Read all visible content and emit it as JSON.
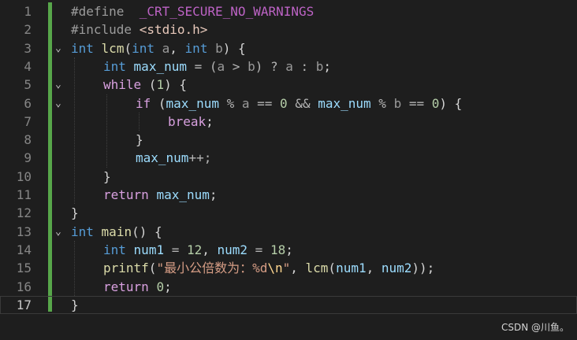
{
  "editor": {
    "lines": [
      {
        "num": "1",
        "fold": "",
        "tokens": [
          {
            "t": "#define",
            "c": "pre"
          },
          {
            "t": "  ",
            "c": "punct"
          },
          {
            "t": "_CRT_SECURE_NO_WARNINGS",
            "c": "macro"
          }
        ],
        "indent": 0
      },
      {
        "num": "2",
        "fold": "",
        "tokens": [
          {
            "t": "#include",
            "c": "pre"
          },
          {
            "t": " ",
            "c": "punct"
          },
          {
            "t": "<stdio.h>",
            "c": "inc"
          }
        ],
        "indent": 0
      },
      {
        "num": "3",
        "fold": "⌄",
        "tokens": [
          {
            "t": "int",
            "c": "kw"
          },
          {
            "t": " ",
            "c": "punct"
          },
          {
            "t": "lcm",
            "c": "fn"
          },
          {
            "t": "(",
            "c": "punct"
          },
          {
            "t": "int",
            "c": "kw"
          },
          {
            "t": " ",
            "c": "punct"
          },
          {
            "t": "a",
            "c": "param"
          },
          {
            "t": ", ",
            "c": "punct"
          },
          {
            "t": "int",
            "c": "kw"
          },
          {
            "t": " ",
            "c": "punct"
          },
          {
            "t": "b",
            "c": "param"
          },
          {
            "t": ") {",
            "c": "punct"
          }
        ],
        "indent": 0
      },
      {
        "num": "4",
        "fold": "",
        "tokens": [
          {
            "t": "int",
            "c": "kw"
          },
          {
            "t": " ",
            "c": "punct"
          },
          {
            "t": "max_num",
            "c": "var"
          },
          {
            "t": " = (",
            "c": "op"
          },
          {
            "t": "a",
            "c": "param"
          },
          {
            "t": " > ",
            "c": "op"
          },
          {
            "t": "b",
            "c": "param"
          },
          {
            "t": ") ? ",
            "c": "op"
          },
          {
            "t": "a",
            "c": "param"
          },
          {
            "t": " : ",
            "c": "op"
          },
          {
            "t": "b",
            "c": "param"
          },
          {
            "t": ";",
            "c": "punct"
          }
        ],
        "indent": 1
      },
      {
        "num": "5",
        "fold": "⌄",
        "tokens": [
          {
            "t": "while",
            "c": "ctrl"
          },
          {
            "t": " (",
            "c": "punct"
          },
          {
            "t": "1",
            "c": "num"
          },
          {
            "t": ") {",
            "c": "punct"
          }
        ],
        "indent": 1
      },
      {
        "num": "6",
        "fold": "⌄",
        "tokens": [
          {
            "t": "if",
            "c": "ctrl"
          },
          {
            "t": " (",
            "c": "punct"
          },
          {
            "t": "max_num",
            "c": "var"
          },
          {
            "t": " % ",
            "c": "op"
          },
          {
            "t": "a",
            "c": "param"
          },
          {
            "t": " == ",
            "c": "op"
          },
          {
            "t": "0",
            "c": "num"
          },
          {
            "t": " && ",
            "c": "op"
          },
          {
            "t": "max_num",
            "c": "var"
          },
          {
            "t": " % ",
            "c": "op"
          },
          {
            "t": "b",
            "c": "param"
          },
          {
            "t": " == ",
            "c": "op"
          },
          {
            "t": "0",
            "c": "num"
          },
          {
            "t": ") {",
            "c": "punct"
          }
        ],
        "indent": 2
      },
      {
        "num": "7",
        "fold": "",
        "tokens": [
          {
            "t": "break",
            "c": "ctrl"
          },
          {
            "t": ";",
            "c": "punct"
          }
        ],
        "indent": 3
      },
      {
        "num": "8",
        "fold": "",
        "tokens": [
          {
            "t": "}",
            "c": "punct"
          }
        ],
        "indent": 2
      },
      {
        "num": "9",
        "fold": "",
        "tokens": [
          {
            "t": "max_num",
            "c": "var"
          },
          {
            "t": "++;",
            "c": "op"
          }
        ],
        "indent": 2
      },
      {
        "num": "10",
        "fold": "",
        "tokens": [
          {
            "t": "}",
            "c": "punct"
          }
        ],
        "indent": 1
      },
      {
        "num": "11",
        "fold": "",
        "tokens": [
          {
            "t": "return",
            "c": "ctrl"
          },
          {
            "t": " ",
            "c": "punct"
          },
          {
            "t": "max_num",
            "c": "var"
          },
          {
            "t": ";",
            "c": "punct"
          }
        ],
        "indent": 1
      },
      {
        "num": "12",
        "fold": "",
        "tokens": [
          {
            "t": "}",
            "c": "punct"
          }
        ],
        "indent": 0
      },
      {
        "num": "13",
        "fold": "⌄",
        "tokens": [
          {
            "t": "int",
            "c": "kw"
          },
          {
            "t": " ",
            "c": "punct"
          },
          {
            "t": "main",
            "c": "fn"
          },
          {
            "t": "() {",
            "c": "punct"
          }
        ],
        "indent": 0
      },
      {
        "num": "14",
        "fold": "",
        "tokens": [
          {
            "t": "int",
            "c": "kw"
          },
          {
            "t": " ",
            "c": "punct"
          },
          {
            "t": "num1",
            "c": "var"
          },
          {
            "t": " = ",
            "c": "op"
          },
          {
            "t": "12",
            "c": "num"
          },
          {
            "t": ", ",
            "c": "punct"
          },
          {
            "t": "num2",
            "c": "var"
          },
          {
            "t": " = ",
            "c": "op"
          },
          {
            "t": "18",
            "c": "num"
          },
          {
            "t": ";",
            "c": "punct"
          }
        ],
        "indent": 1
      },
      {
        "num": "15",
        "fold": "",
        "tokens": [
          {
            "t": "printf",
            "c": "fn"
          },
          {
            "t": "(",
            "c": "punct"
          },
          {
            "t": "\"最小公倍数为：%d",
            "c": "str"
          },
          {
            "t": "\\n",
            "c": "esc"
          },
          {
            "t": "\"",
            "c": "str"
          },
          {
            "t": ", ",
            "c": "punct"
          },
          {
            "t": "lcm",
            "c": "fn"
          },
          {
            "t": "(",
            "c": "punct"
          },
          {
            "t": "num1",
            "c": "var"
          },
          {
            "t": ", ",
            "c": "punct"
          },
          {
            "t": "num2",
            "c": "var"
          },
          {
            "t": "));",
            "c": "punct"
          }
        ],
        "indent": 1
      },
      {
        "num": "16",
        "fold": "",
        "tokens": [
          {
            "t": "return",
            "c": "ctrl"
          },
          {
            "t": " ",
            "c": "punct"
          },
          {
            "t": "0",
            "c": "num"
          },
          {
            "t": ";",
            "c": "punct"
          }
        ],
        "indent": 1
      },
      {
        "num": "17",
        "fold": "",
        "tokens": [
          {
            "t": "}",
            "c": "punct"
          }
        ],
        "indent": 0
      }
    ],
    "current_line": "17"
  },
  "watermark": "CSDN @川鱼。",
  "colors": {
    "background": "#1e1e1e",
    "change_bar": "#57a64a",
    "keyword": "#569cd6",
    "control": "#d8a0df",
    "function": "#dcdcaa",
    "variable": "#9cdcfe",
    "number": "#b5cea8",
    "string": "#d69d85"
  }
}
